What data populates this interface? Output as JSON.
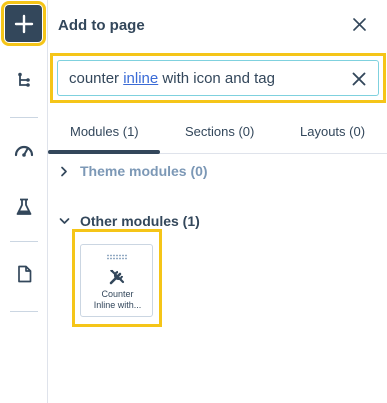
{
  "rail": {
    "items": [
      {
        "name": "add",
        "icon": "plus-icon"
      },
      {
        "name": "tree",
        "icon": "tree-icon"
      },
      {
        "name": "performance",
        "icon": "gauge-icon"
      },
      {
        "name": "test",
        "icon": "flask-icon"
      },
      {
        "name": "page",
        "icon": "document-icon"
      }
    ]
  },
  "panel": {
    "title": "Add to page",
    "search": {
      "value_before": "counter ",
      "value_misspelled": "inline",
      "value_after": " with icon and tag"
    },
    "tabs": [
      {
        "label": "Modules (1)",
        "active": true
      },
      {
        "label": "Sections (0)",
        "active": false
      },
      {
        "label": "Layouts (0)",
        "active": false
      }
    ],
    "groups": [
      {
        "label": "Theme modules (0)",
        "expanded": false
      },
      {
        "label": "Other modules (1)",
        "expanded": true
      }
    ],
    "modules": [
      {
        "label_line1": "Counter",
        "label_line2": "Inline with...",
        "icon": "tools-icon"
      }
    ]
  },
  "colors": {
    "highlight": "#f5c518",
    "text": "#33475b",
    "muted": "#7c98b6",
    "focus_border": "#7fd1de"
  }
}
